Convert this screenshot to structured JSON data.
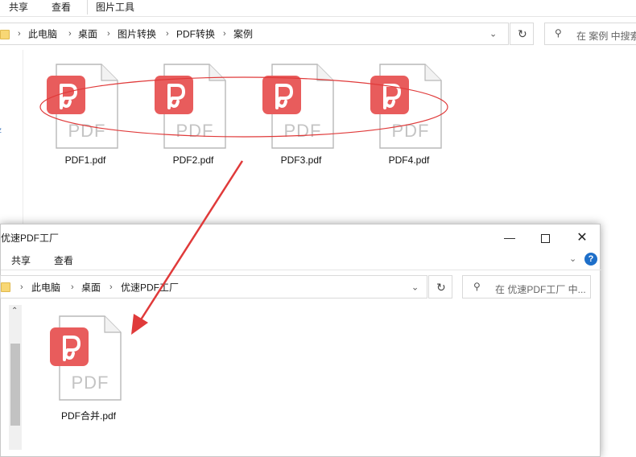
{
  "back_window": {
    "ribbon_tabs": [
      "共享",
      "查看",
      "图片工具"
    ],
    "breadcrumb": [
      "此电脑",
      "桌面",
      "图片转换",
      "PDF转换",
      "案例"
    ],
    "search_placeholder": "在 案例 中搜索",
    "files": [
      "PDF1.pdf",
      "PDF2.pdf",
      "PDF3.pdf",
      "PDF4.pdf"
    ],
    "side_marker": "z"
  },
  "front_window": {
    "title": "优速PDF工厂",
    "ribbon_tabs": [
      "共享",
      "查看"
    ],
    "breadcrumb": [
      "此电脑",
      "桌面",
      "优速PDF工厂"
    ],
    "search_placeholder": "在 优速PDF工厂 中...",
    "files": [
      "PDF合并.pdf"
    ],
    "help_label": "?"
  },
  "file_icon": {
    "text": "PDF",
    "badge_color": "#e85c5c"
  },
  "annotation_color": "#e03a3a"
}
